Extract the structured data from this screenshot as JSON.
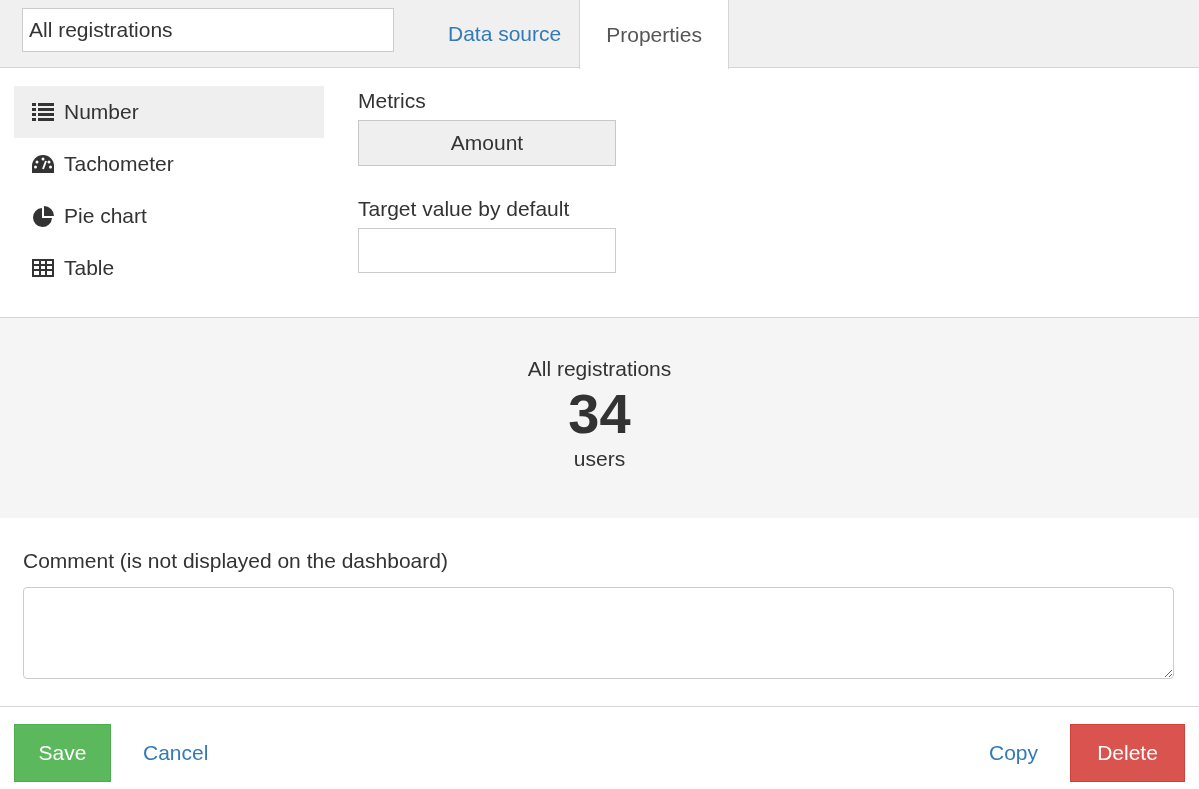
{
  "header": {
    "name_value": "All registrations",
    "tabs": [
      {
        "label": "Data source",
        "selected": false
      },
      {
        "label": "Properties",
        "selected": true
      }
    ]
  },
  "view_types": [
    {
      "kind": "number",
      "label": "Number",
      "selected": true
    },
    {
      "kind": "tachometer",
      "label": "Tachometer",
      "selected": false
    },
    {
      "kind": "pie",
      "label": "Pie chart",
      "selected": false
    },
    {
      "kind": "table",
      "label": "Table",
      "selected": false
    }
  ],
  "metrics": {
    "label": "Metrics",
    "button": "Amount"
  },
  "target": {
    "label": "Target value by default"
  },
  "preview": {
    "title": "All registrations",
    "value": "34",
    "unit": "users"
  },
  "comment": {
    "label": "Comment (is not displayed on the dashboard)"
  },
  "footer": {
    "save": "Save",
    "cancel": "Cancel",
    "copy": "Copy",
    "delete": "Delete"
  }
}
